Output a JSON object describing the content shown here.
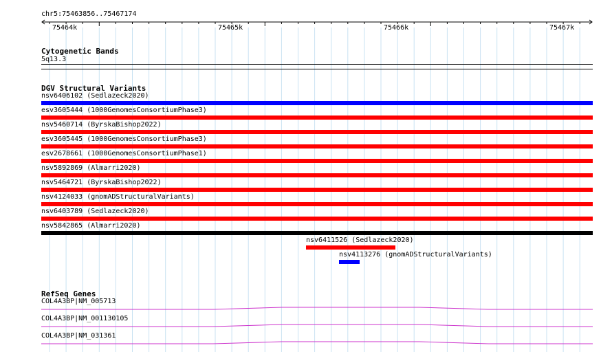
{
  "ruler": {
    "region_label": "chr5:75463856..75467174",
    "ticks": [
      "75464k",
      "75465k",
      "75466k",
      "75467k"
    ]
  },
  "cytoband": {
    "title": "Cytogenetic Bands",
    "band_label": "5q13.3"
  },
  "dgv": {
    "title": "DGV Structural Variants",
    "variants": [
      {
        "label": "nsv6406102 (Sedlazeck2020)",
        "color": "#0000ff"
      },
      {
        "label": "esv3605444 (1000GenomesConsortiumPhase3)",
        "color": "#ff0000"
      },
      {
        "label": "nsv5460714 (ByrskaBishop2022)",
        "color": "#ff0000"
      },
      {
        "label": "esv3605445 (1000GenomesConsortiumPhase3)",
        "color": "#ff0000"
      },
      {
        "label": "esv2678661 (1000GenomesConsortiumPhase1)",
        "color": "#ff0000"
      },
      {
        "label": "nsv5892869 (Almarri2020)",
        "color": "#ff0000"
      },
      {
        "label": "nsv5464721 (ByrskaBishop2022)",
        "color": "#ff0000"
      },
      {
        "label": "nsv4124033 (gnomADStructuralVariants)",
        "color": "#ff0000"
      },
      {
        "label": "nsv6403789 (Sedlazeck2020)",
        "color": "#ff0000"
      },
      {
        "label": "nsv5842865 (Almarri2020)",
        "color": "#000000"
      },
      {
        "label": "nsv6411526 (Sedlazeck2020)",
        "color": "#ff0000"
      },
      {
        "label": "nsv4113276 (gnomADStructuralVariants)",
        "color": "#0000ff"
      }
    ]
  },
  "refseq": {
    "title": "RefSeq Genes",
    "genes": [
      {
        "label": "COL4A3BP|NM_005713",
        "color": "#cc33cc"
      },
      {
        "label": "COL4A3BP|NM_001130105",
        "color": "#cc33cc"
      },
      {
        "label": "COL4A3BP|NM_031361",
        "color": "#cc33cc"
      }
    ]
  },
  "colors": {
    "grid_line": "#c8e2f2",
    "axis": "#000000"
  }
}
